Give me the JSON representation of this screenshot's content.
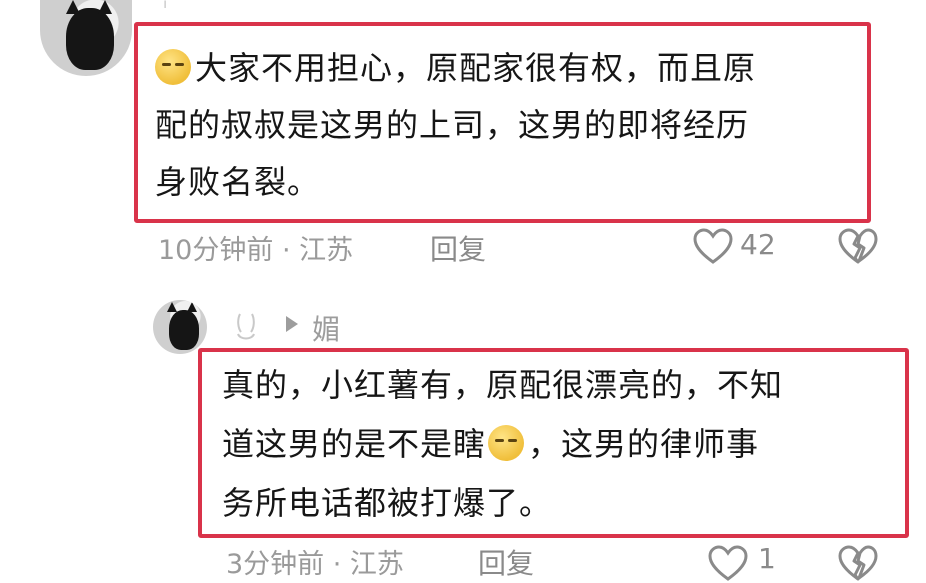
{
  "comment1": {
    "text_line1": "大家不用担心，原配家很有权，而且原",
    "text_line2": "配的叔叔是这男的上司，这男的即将经历",
    "text_line3": "身败名裂。",
    "emoji": "face-emoji",
    "time_location": "10分钟前 · 江苏",
    "reply_label": "回复",
    "likes": "42"
  },
  "comment2": {
    "reply_to": "媚",
    "text_line1": "真的，小红薯有，原配很漂亮的，不知",
    "text_line2_a": "道这男的是不是瞎",
    "text_line2_b": "，这男的律师事",
    "text_line3": "务所电话都被打爆了。",
    "emoji": "face-emoji",
    "time_location": "3分钟前 · 江苏",
    "reply_label": "回复",
    "likes": "1"
  },
  "colors": {
    "highlight": "#d9334a",
    "meta_text": "#9a9a9a"
  }
}
